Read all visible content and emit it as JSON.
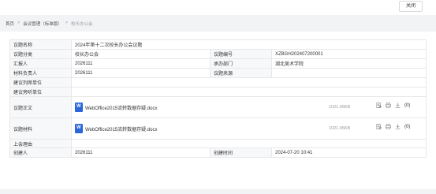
{
  "topbar": {
    "close_label": "关闭"
  },
  "breadcrumb": {
    "home": "首页",
    "sep": ">",
    "meeting_mgmt": "会议管理（标准版）",
    "current": "校长办公会"
  },
  "form": {
    "topic_name": {
      "label": "议题名称",
      "value": "2024年第十二次校长办公会议题"
    },
    "category": {
      "label": "议题分类",
      "value": "校长办公会"
    },
    "topic_no": {
      "label": "议题编号",
      "value": "XZBGH202407200001"
    },
    "reporter": {
      "label": "汇报人",
      "value": "2026111"
    },
    "dept": {
      "label": "承办部门",
      "value": "湖北美术学院"
    },
    "material_owner": {
      "label": "材料负责人",
      "value": "2026111"
    },
    "source": {
      "label": "议题来源",
      "value": ""
    },
    "attend_unit": {
      "label": "建议列席单位",
      "value": ""
    },
    "consult_unit": {
      "label": "建议旁听单位",
      "value": ""
    },
    "main_doc": {
      "label": "议题正文",
      "file_name": "WebOffice2015流转数据存疑.docx",
      "file_size": "1021.95KB",
      "download_count": "(0)"
    },
    "materials": {
      "label": "议题材料",
      "file_name": "WebOffice2015流转数据存疑.docx",
      "file_size": "1021.95KB",
      "download_count": "(0)"
    },
    "reason": {
      "label": "上会理由",
      "value": ""
    },
    "creator": {
      "label": "创建人",
      "value": "2026111"
    },
    "created_at": {
      "label": "创建时间",
      "value": "2024-07-20 10:41"
    }
  },
  "icons": {
    "doc": "docx-file-icon",
    "preview": "preview-icon",
    "print": "print-icon",
    "download": "download-icon"
  },
  "colors": {
    "accent": "#2b66d9",
    "label_bg": "#f7f8fa",
    "border": "#e8e8e8"
  }
}
